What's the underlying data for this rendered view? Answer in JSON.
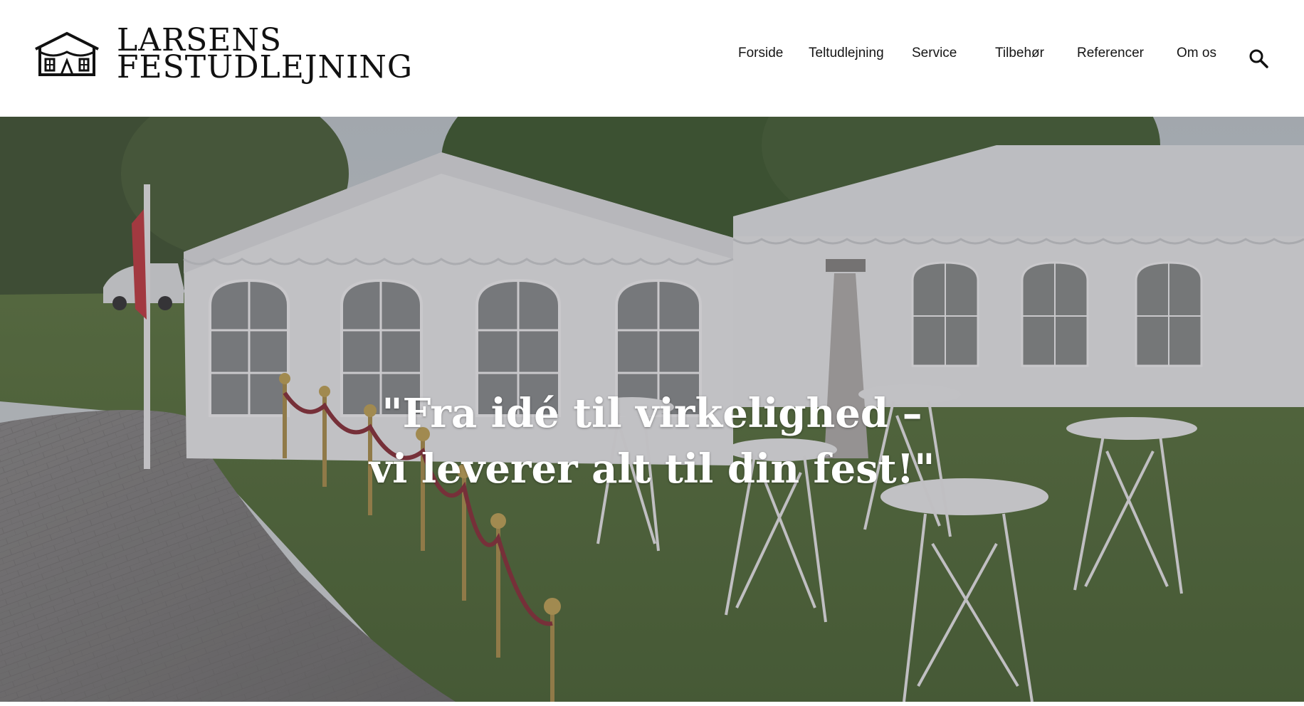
{
  "header": {
    "logo": {
      "line1": "LARSENS",
      "line2": "FESTUDLEJNING",
      "icon": "tent-house-icon"
    },
    "nav": [
      {
        "label": "Forside"
      },
      {
        "label": "Teltudlejning"
      },
      {
        "label": "Service"
      },
      {
        "label": "Tilbehør"
      },
      {
        "label": "Referencer"
      },
      {
        "label": "Om os"
      }
    ],
    "search_icon": "search-icon"
  },
  "hero": {
    "headline_line1": "\"Fra idé til virkelighed –",
    "headline_line2": "vi leverer alt til din fest!\""
  },
  "colors": {
    "text": "#151515",
    "hero_text": "#ffffff",
    "background": "#ffffff"
  }
}
